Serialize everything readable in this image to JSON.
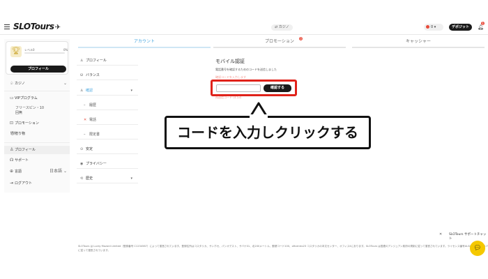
{
  "header": {
    "logo": "SLOTours",
    "casino_chip": "⇄ カジノ",
    "coin_value": "0",
    "deposit_label": "デポジット",
    "notification_count": "1"
  },
  "sidebar": {
    "level_label": "レベル0",
    "level_pct": "0%",
    "profile_button": "プロフィール",
    "items": [
      {
        "label": "カジノ"
      },
      {
        "label": "VIPプログラム"
      },
      {
        "label": "フリースピン・10\n回無"
      },
      {
        "label": "プロモーション"
      },
      {
        "label": "贈り物"
      },
      {
        "label": "プロフィール"
      },
      {
        "label": "サポート"
      },
      {
        "label": "言語",
        "value": "日本語"
      },
      {
        "label": "ログアウト"
      }
    ]
  },
  "tabs": [
    {
      "label": "アカウント",
      "active": true
    },
    {
      "label": "プロモーション",
      "badge": "0"
    },
    {
      "label": "キャッシャー"
    }
  ],
  "submenu": {
    "items": [
      {
        "label": "プロフィール"
      },
      {
        "label": "バランス"
      },
      {
        "label": "確認"
      },
      {
        "label": "履歴"
      },
      {
        "label": "電話"
      },
      {
        "label": "限定書"
      },
      {
        "label": "安定"
      },
      {
        "label": "プライバシー"
      },
      {
        "label": "歴史"
      }
    ]
  },
  "auth": {
    "title": "モバイル認証",
    "description": "電話番号を確認するためのコードを送信しました",
    "note": "確認コードを入力します",
    "input_placeholder": "",
    "confirm_button": "確認する",
    "resend": "再送信コード (4:53)"
  },
  "callout": {
    "text": "コードを入力しクリックする"
  },
  "footer": {
    "text": "SLOTours は Lucky Mozard Limited（登録番号 C1234567）によって運営されています。登録住所はコスタリカ、サンホセ、パシオデスト、サバナ01、北200メートル、郵便コード100、oficentro23 コスタリカの本文センター、オフィス4にあります。SLOTours は国連のアンジュアン政府の規制に従って運営されています。ライセンス番号ALSI-202409070-FI に従って運営されています。"
  },
  "support": {
    "label": "SLOTours サポートチャット"
  },
  "colors": {
    "accent_red": "#e0221a",
    "active_tab": "#4aa8e0",
    "dark": "#1a1a1a",
    "chat_yellow": "#f5c800"
  }
}
